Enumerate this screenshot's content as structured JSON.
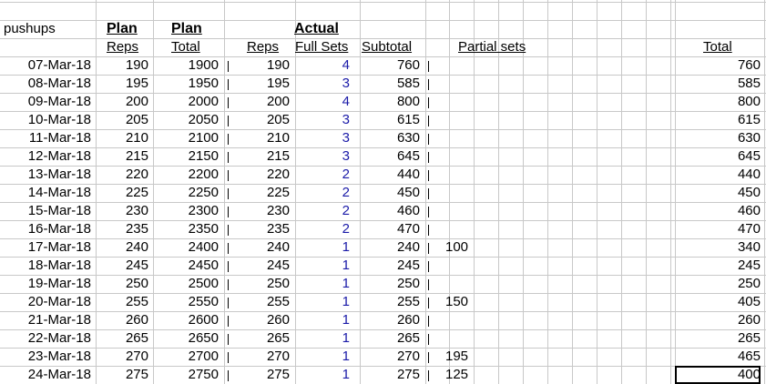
{
  "sheet": {
    "title_cell": "pushups",
    "headers_top": {
      "plan1": "Plan",
      "plan2": "Plan",
      "actual": "Actual"
    },
    "headers_sub": {
      "plan_reps": "Reps",
      "plan_total": "Total",
      "reps": "Reps",
      "full_sets": "Full Sets",
      "subtotal": "Subtotal",
      "partial_sets": "Partial sets",
      "total": "Total"
    },
    "rows": [
      {
        "date": "07-Mar-18",
        "plan_reps": "190",
        "plan_total": "1900",
        "reps": "190",
        "full_sets": "4",
        "subtotal": "760",
        "partial": "",
        "total": "760"
      },
      {
        "date": "08-Mar-18",
        "plan_reps": "195",
        "plan_total": "1950",
        "reps": "195",
        "full_sets": "3",
        "subtotal": "585",
        "partial": "",
        "total": "585"
      },
      {
        "date": "09-Mar-18",
        "plan_reps": "200",
        "plan_total": "2000",
        "reps": "200",
        "full_sets": "4",
        "subtotal": "800",
        "partial": "",
        "total": "800"
      },
      {
        "date": "10-Mar-18",
        "plan_reps": "205",
        "plan_total": "2050",
        "reps": "205",
        "full_sets": "3",
        "subtotal": "615",
        "partial": "",
        "total": "615"
      },
      {
        "date": "11-Mar-18",
        "plan_reps": "210",
        "plan_total": "2100",
        "reps": "210",
        "full_sets": "3",
        "subtotal": "630",
        "partial": "",
        "total": "630"
      },
      {
        "date": "12-Mar-18",
        "plan_reps": "215",
        "plan_total": "2150",
        "reps": "215",
        "full_sets": "3",
        "subtotal": "645",
        "partial": "",
        "total": "645"
      },
      {
        "date": "13-Mar-18",
        "plan_reps": "220",
        "plan_total": "2200",
        "reps": "220",
        "full_sets": "2",
        "subtotal": "440",
        "partial": "",
        "total": "440"
      },
      {
        "date": "14-Mar-18",
        "plan_reps": "225",
        "plan_total": "2250",
        "reps": "225",
        "full_sets": "2",
        "subtotal": "450",
        "partial": "",
        "total": "450"
      },
      {
        "date": "15-Mar-18",
        "plan_reps": "230",
        "plan_total": "2300",
        "reps": "230",
        "full_sets": "2",
        "subtotal": "460",
        "partial": "",
        "total": "460"
      },
      {
        "date": "16-Mar-18",
        "plan_reps": "235",
        "plan_total": "2350",
        "reps": "235",
        "full_sets": "2",
        "subtotal": "470",
        "partial": "",
        "total": "470"
      },
      {
        "date": "17-Mar-18",
        "plan_reps": "240",
        "plan_total": "2400",
        "reps": "240",
        "full_sets": "1",
        "subtotal": "240",
        "partial": "100",
        "total": "340"
      },
      {
        "date": "18-Mar-18",
        "plan_reps": "245",
        "plan_total": "2450",
        "reps": "245",
        "full_sets": "1",
        "subtotal": "245",
        "partial": "",
        "total": "245"
      },
      {
        "date": "19-Mar-18",
        "plan_reps": "250",
        "plan_total": "2500",
        "reps": "250",
        "full_sets": "1",
        "subtotal": "250",
        "partial": "",
        "total": "250"
      },
      {
        "date": "20-Mar-18",
        "plan_reps": "255",
        "plan_total": "2550",
        "reps": "255",
        "full_sets": "1",
        "subtotal": "255",
        "partial": "150",
        "total": "405"
      },
      {
        "date": "21-Mar-18",
        "plan_reps": "260",
        "plan_total": "2600",
        "reps": "260",
        "full_sets": "1",
        "subtotal": "260",
        "partial": "",
        "total": "260"
      },
      {
        "date": "22-Mar-18",
        "plan_reps": "265",
        "plan_total": "2650",
        "reps": "265",
        "full_sets": "1",
        "subtotal": "265",
        "partial": "",
        "total": "265"
      },
      {
        "date": "23-Mar-18",
        "plan_reps": "270",
        "plan_total": "2700",
        "reps": "270",
        "full_sets": "1",
        "subtotal": "270",
        "partial": "195",
        "total": "465"
      },
      {
        "date": "24-Mar-18",
        "plan_reps": "275",
        "plan_total": "2750",
        "reps": "275",
        "full_sets": "1",
        "subtotal": "275",
        "partial": "125",
        "total": "400"
      }
    ],
    "selected_row_index": 17,
    "colors": {
      "gridline": "#c8c8c8",
      "full_sets_text": "#1a1aa8",
      "selection": "#000000"
    }
  }
}
